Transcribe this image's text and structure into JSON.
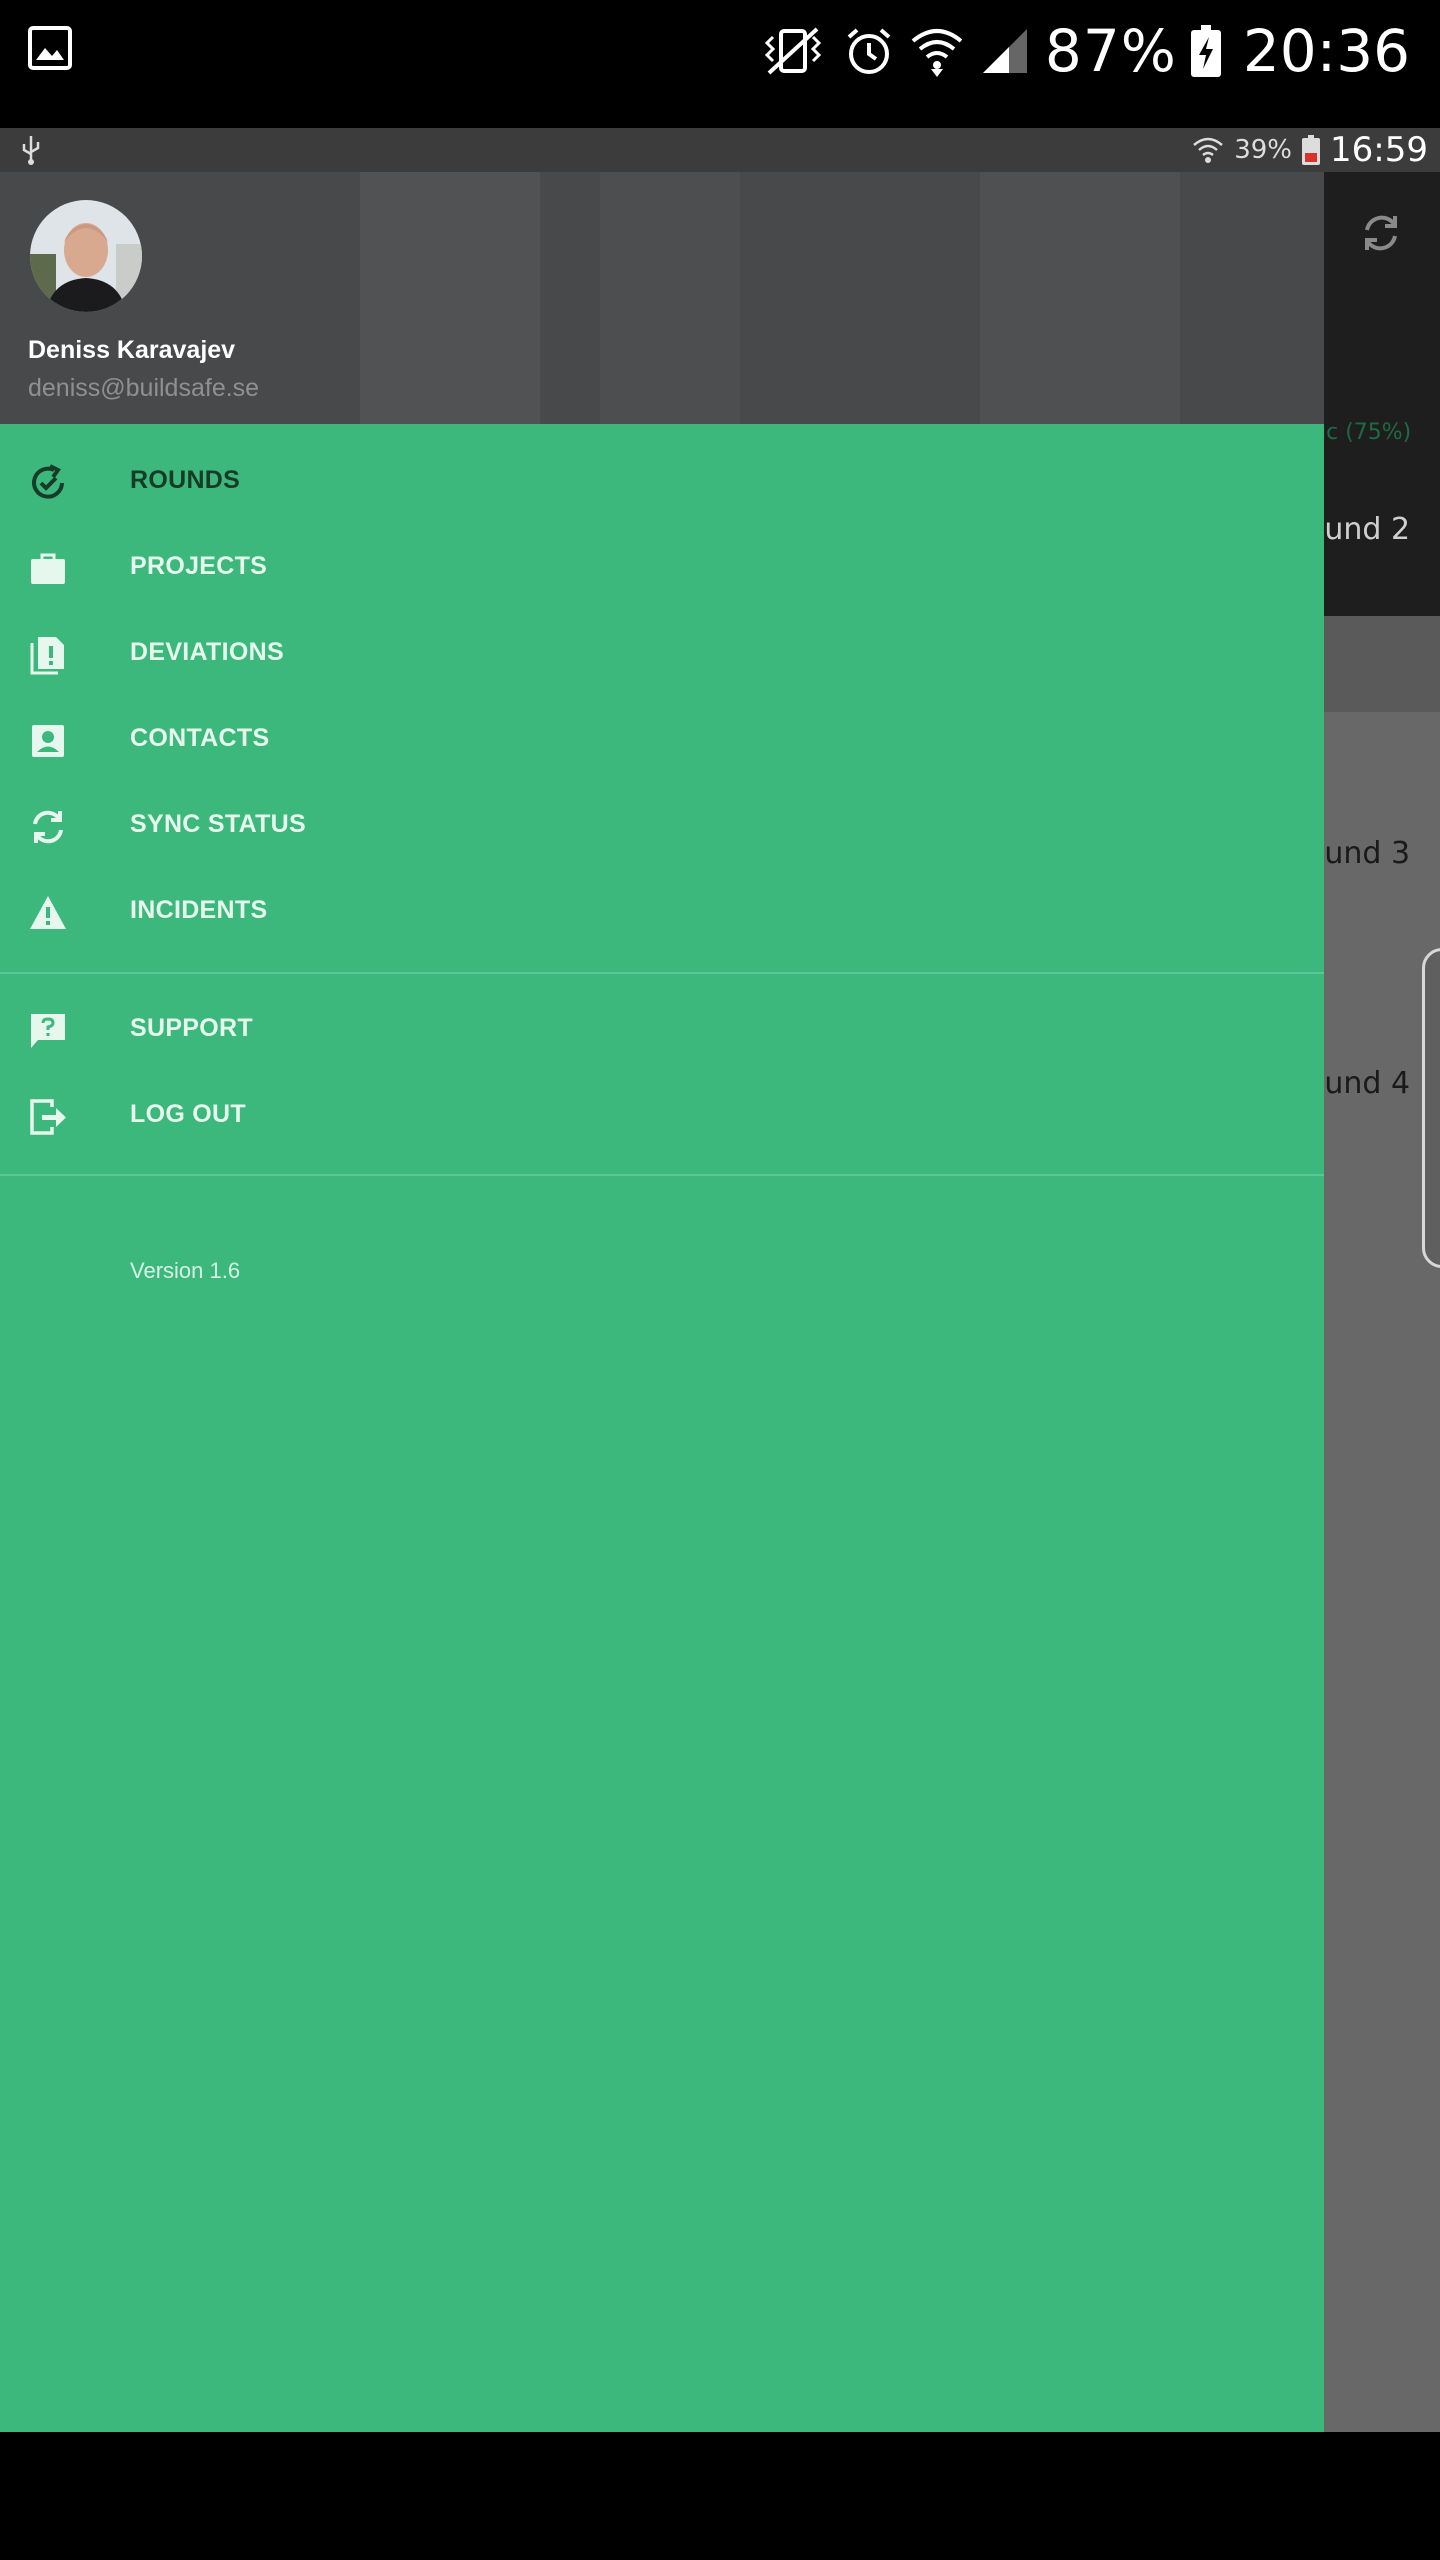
{
  "outer_status_bar": {
    "battery_percent": "87%",
    "time": "20:36",
    "icons": [
      "gallery-icon",
      "vibrate-icon",
      "alarm-icon",
      "wifi-icon",
      "signal-icon",
      "battery-charging-icon"
    ]
  },
  "inner_status_bar": {
    "battery_percent": "39%",
    "time": "16:59",
    "icons": [
      "usb-icon",
      "wifi-icon",
      "battery-low-icon"
    ]
  },
  "background_app": {
    "progress_text": "ic (75%)",
    "rows": [
      "ound 2",
      "ound 3",
      "ound 4"
    ]
  },
  "drawer": {
    "user": {
      "name": "Deniss Karavajev",
      "email": "deniss@buildsafe.se"
    },
    "primary_items": [
      {
        "label": "ROUNDS",
        "icon": "rounds-check-icon",
        "active": true
      },
      {
        "label": "PROJECTS",
        "icon": "briefcase-icon",
        "active": false
      },
      {
        "label": "DEVIATIONS",
        "icon": "document-alert-icon",
        "active": false
      },
      {
        "label": "CONTACTS",
        "icon": "contact-card-icon",
        "active": false
      },
      {
        "label": "SYNC STATUS",
        "icon": "sync-icon",
        "active": false
      },
      {
        "label": "INCIDENTS",
        "icon": "warning-icon",
        "active": false
      }
    ],
    "secondary_items": [
      {
        "label": "SUPPORT",
        "icon": "help-chat-icon"
      },
      {
        "label": "LOG OUT",
        "icon": "logout-icon"
      }
    ],
    "version": "Version 1.6"
  },
  "colors": {
    "drawer_green": "#3db87c",
    "header_gray": "#48494b",
    "active_label": "#173b28"
  }
}
